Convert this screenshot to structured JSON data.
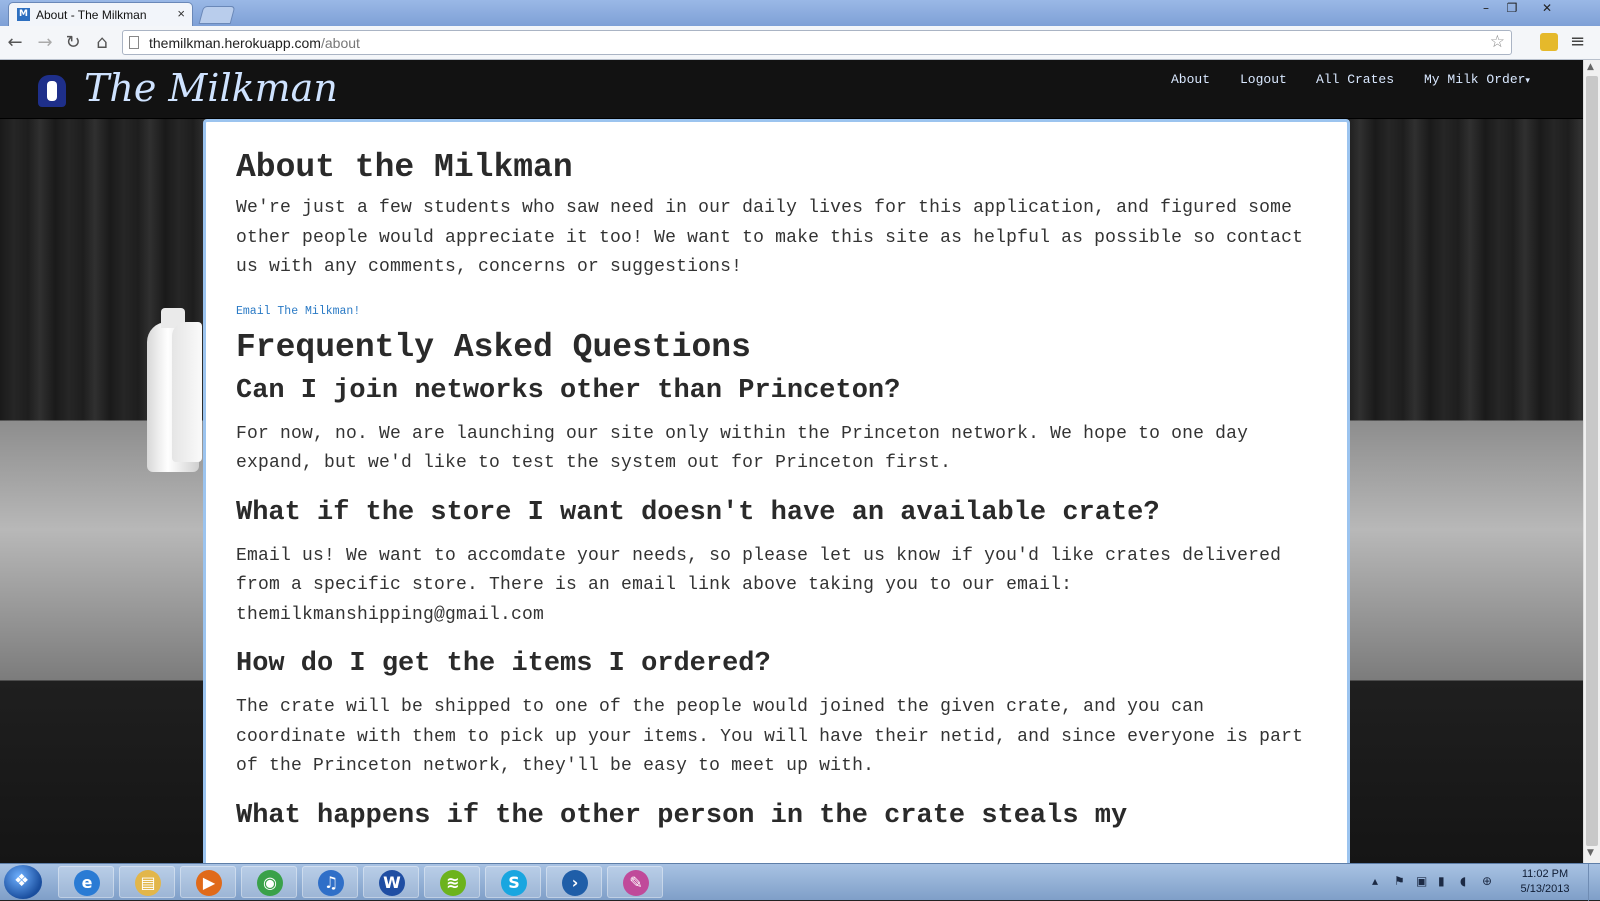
{
  "browser": {
    "tab": {
      "title": "About - The Milkman",
      "favicon": "M",
      "close": "×"
    },
    "controls": {
      "minimize": "–",
      "maximize": "❐",
      "close": "✕"
    },
    "nav": {
      "back": "←",
      "forward": "→",
      "reload": "↻",
      "home": "⌂"
    },
    "address": {
      "host": "themilkman.herokuapp.com",
      "path": "/about"
    },
    "bookmark_star": "☆",
    "menu": "≡"
  },
  "site": {
    "brand": "The Milkman",
    "nav": [
      {
        "label": "About"
      },
      {
        "label": "Logout"
      },
      {
        "label": "All Crates"
      },
      {
        "label": "My Milk Order"
      }
    ],
    "dropdown_caret": "▾"
  },
  "about": {
    "title": "About the Milkman",
    "intro": "We're just a few students who saw need in our daily lives for this application, and figured some other people would appreciate it too! We want to make this site as helpful as possible so contact us with any comments, concerns or suggestions!",
    "email_link": "Email The Milkman!"
  },
  "faq": {
    "title": "Frequently Asked Questions",
    "items": [
      {
        "question": "Can I join networks other than Princeton?",
        "answer": "For now, no. We are launching our site only within the Princeton network. We hope to one day expand, but we'd like to test the system out for Princeton first."
      },
      {
        "question": "What if the store I want doesn't have an available crate?",
        "answer": "Email us! We want to accomdate your needs, so please let us know if you'd like crates delivered from a specific store. There is an email link above taking you to our email: themilkmanshipping@gmail.com"
      },
      {
        "question": "How do I get the items I ordered?",
        "answer": "The crate will be shipped to one of the people would joined the given crate, and you can coordinate with them to pick up your items. You will have their netid, and since everyone is part of the Princeton network, they'll be easy to meet up with."
      },
      {
        "question": "What happens if the other person in the crate steals my",
        "answer": ""
      }
    ]
  },
  "scrollbar": {
    "up": "▲",
    "down": "▼",
    "scroll_fraction": 0.02
  },
  "taskbar": {
    "start_glyph": "❖",
    "apps": [
      {
        "name": "internet-explorer",
        "glyph": "e",
        "color": "#2a7bd4"
      },
      {
        "name": "windows-explorer",
        "glyph": "▤",
        "color": "#e2b64a"
      },
      {
        "name": "media-player",
        "glyph": "▶",
        "color": "#e06a1a"
      },
      {
        "name": "chrome",
        "glyph": "◉",
        "color": "#3aa14a"
      },
      {
        "name": "itunes",
        "glyph": "♫",
        "color": "#2f6fc8"
      },
      {
        "name": "word",
        "glyph": "W",
        "color": "#1f4ea3"
      },
      {
        "name": "spotify",
        "glyph": "≋",
        "color": "#6cb31d"
      },
      {
        "name": "skype",
        "glyph": "S",
        "color": "#19a6e0"
      },
      {
        "name": "powershell",
        "glyph": "›",
        "color": "#1f5ea8"
      },
      {
        "name": "paint",
        "glyph": "✎",
        "color": "#c04a9a"
      }
    ],
    "tray": [
      "▴",
      "⚑",
      "▣",
      "▮",
      "◖",
      "⊕"
    ],
    "time": "11:02 PM",
    "date": "5/13/2013"
  }
}
